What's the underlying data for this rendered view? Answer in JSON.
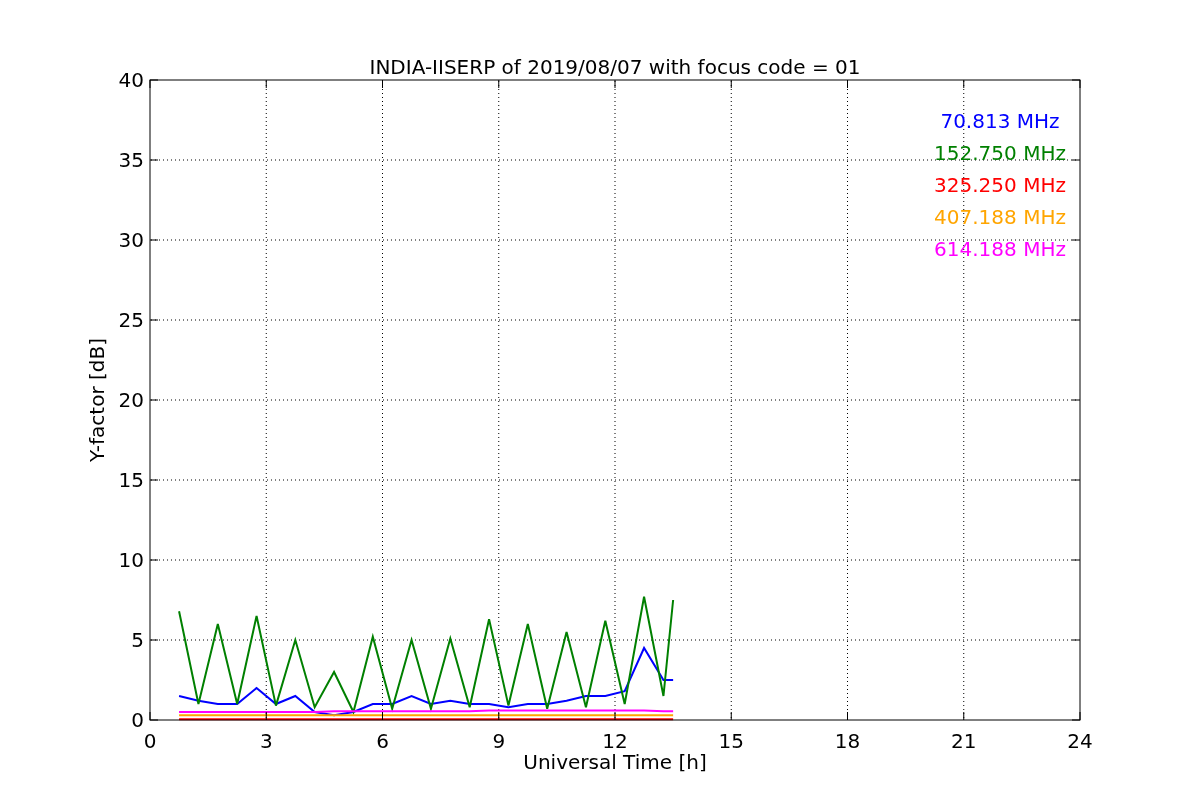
{
  "figure": {
    "chart_data": {
      "type": "line",
      "grid": true,
      "title": "INDIA-IISERP of 2019/08/07 with focus code = 01",
      "xlabel": "Universal Time [h]",
      "ylabel": "Y-factor [dB]",
      "xlim": [
        0,
        24
      ],
      "ylim": [
        0,
        40
      ],
      "xticks": [
        0,
        3,
        6,
        9,
        12,
        15,
        18,
        21,
        24
      ],
      "yticks": [
        0,
        5,
        10,
        15,
        20,
        25,
        30,
        35,
        40
      ],
      "x": [
        0.75,
        1.25,
        1.75,
        2.25,
        2.75,
        3.25,
        3.75,
        4.25,
        4.75,
        5.25,
        5.75,
        6.25,
        6.75,
        7.25,
        7.75,
        8.25,
        8.75,
        9.25,
        9.75,
        10.25,
        10.75,
        11.25,
        11.75,
        12.25,
        12.75,
        13.25,
        13.5
      ],
      "series": [
        {
          "name": "70.813 MHz",
          "color": "#0000ff",
          "values": [
            1.5,
            1.2,
            1.0,
            1.0,
            2.0,
            1.0,
            1.5,
            0.5,
            0.3,
            0.5,
            1.0,
            1.0,
            1.5,
            1.0,
            1.2,
            1.0,
            1.0,
            0.8,
            1.0,
            1.0,
            1.2,
            1.5,
            1.5,
            1.8,
            4.5,
            2.5,
            2.5
          ]
        },
        {
          "name": "152.750 MHz",
          "color": "#008000",
          "values": [
            6.8,
            1.0,
            6.0,
            1.0,
            6.5,
            0.9,
            5.0,
            0.8,
            3.0,
            0.5,
            5.2,
            0.7,
            5.0,
            0.7,
            5.1,
            0.8,
            6.3,
            0.9,
            6.0,
            0.7,
            5.5,
            0.8,
            6.2,
            1.0,
            7.7,
            1.5,
            7.5
          ]
        },
        {
          "name": "325.250 MHz",
          "color": "#ff0000",
          "values": [
            0.05,
            0.05,
            0.05,
            0.05,
            0.05,
            0.05,
            0.05,
            0.05,
            0.05,
            0.05,
            0.05,
            0.05,
            0.05,
            0.05,
            0.05,
            0.05,
            0.05,
            0.05,
            0.05,
            0.05,
            0.05,
            0.05,
            0.05,
            0.05,
            0.05,
            0.05,
            0.05
          ]
        },
        {
          "name": "407.188 MHz",
          "color": "#ffa500",
          "values": [
            0.3,
            0.3,
            0.3,
            0.3,
            0.3,
            0.3,
            0.3,
            0.3,
            0.3,
            0.3,
            0.3,
            0.3,
            0.3,
            0.3,
            0.3,
            0.3,
            0.3,
            0.3,
            0.3,
            0.3,
            0.3,
            0.3,
            0.3,
            0.3,
            0.3,
            0.3,
            0.3
          ]
        },
        {
          "name": "614.188 MHz",
          "color": "#ff00ff",
          "values": [
            0.5,
            0.5,
            0.5,
            0.5,
            0.5,
            0.5,
            0.5,
            0.5,
            0.55,
            0.55,
            0.55,
            0.55,
            0.55,
            0.55,
            0.55,
            0.55,
            0.6,
            0.6,
            0.6,
            0.6,
            0.6,
            0.6,
            0.6,
            0.6,
            0.6,
            0.55,
            0.55
          ]
        }
      ]
    }
  }
}
